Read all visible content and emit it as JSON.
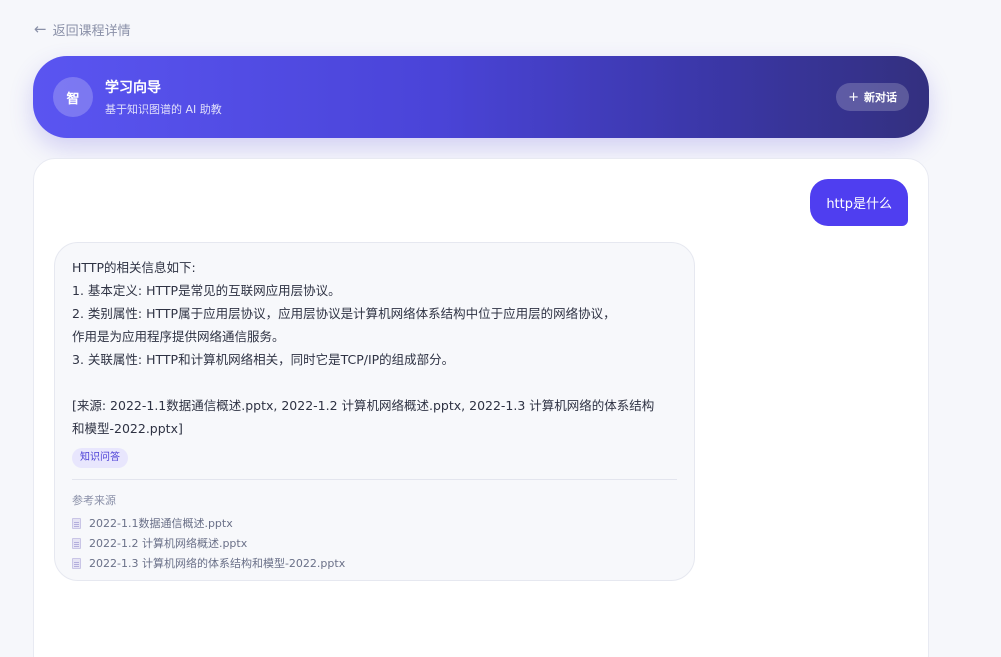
{
  "nav": {
    "back_label": "返回课程详情"
  },
  "header": {
    "avatar_text": "智",
    "title": "学习向导",
    "subtitle": "基于知识图谱的 AI 助教",
    "new_chat_label": "新对话"
  },
  "chat": {
    "user_message": "http是什么",
    "bot_message": {
      "lines": [
        "HTTP的相关信息如下:",
        "1. 基本定义: HTTP是常见的互联网应用层协议。",
        "2. 类别属性: HTTP属于应用层协议，应用层协议是计算机网络体系结构中位于应用层的网络协议，",
        "作用是为应用程序提供网络通信服务。",
        "3. 关联属性: HTTP和计算机网络相关，同时它是TCP/IP的组成部分。",
        "[来源: 2022-1.1数据通信概述.pptx, 2022-1.2 计算机网络概述.pptx, 2022-1.3 计算机网络的体系结构",
        "和模型-2022.pptx]"
      ],
      "tag": "知识问答",
      "sources_title": "参考来源",
      "sources": [
        "2022-1.1数据通信概述.pptx",
        "2022-1.2 计算机网络概述.pptx",
        "2022-1.3 计算机网络的体系结构和模型-2022.pptx"
      ]
    }
  },
  "colors": {
    "accent": "#4f3ef0",
    "header_gradient_start": "#5a55f1",
    "header_gradient_end": "#33307f",
    "tag_bg": "#e8e6fd",
    "tag_text": "#4b3fd6"
  },
  "icons": {
    "back": "arrow-left-icon",
    "new_chat": "plus-icon",
    "source": "file-icon"
  }
}
